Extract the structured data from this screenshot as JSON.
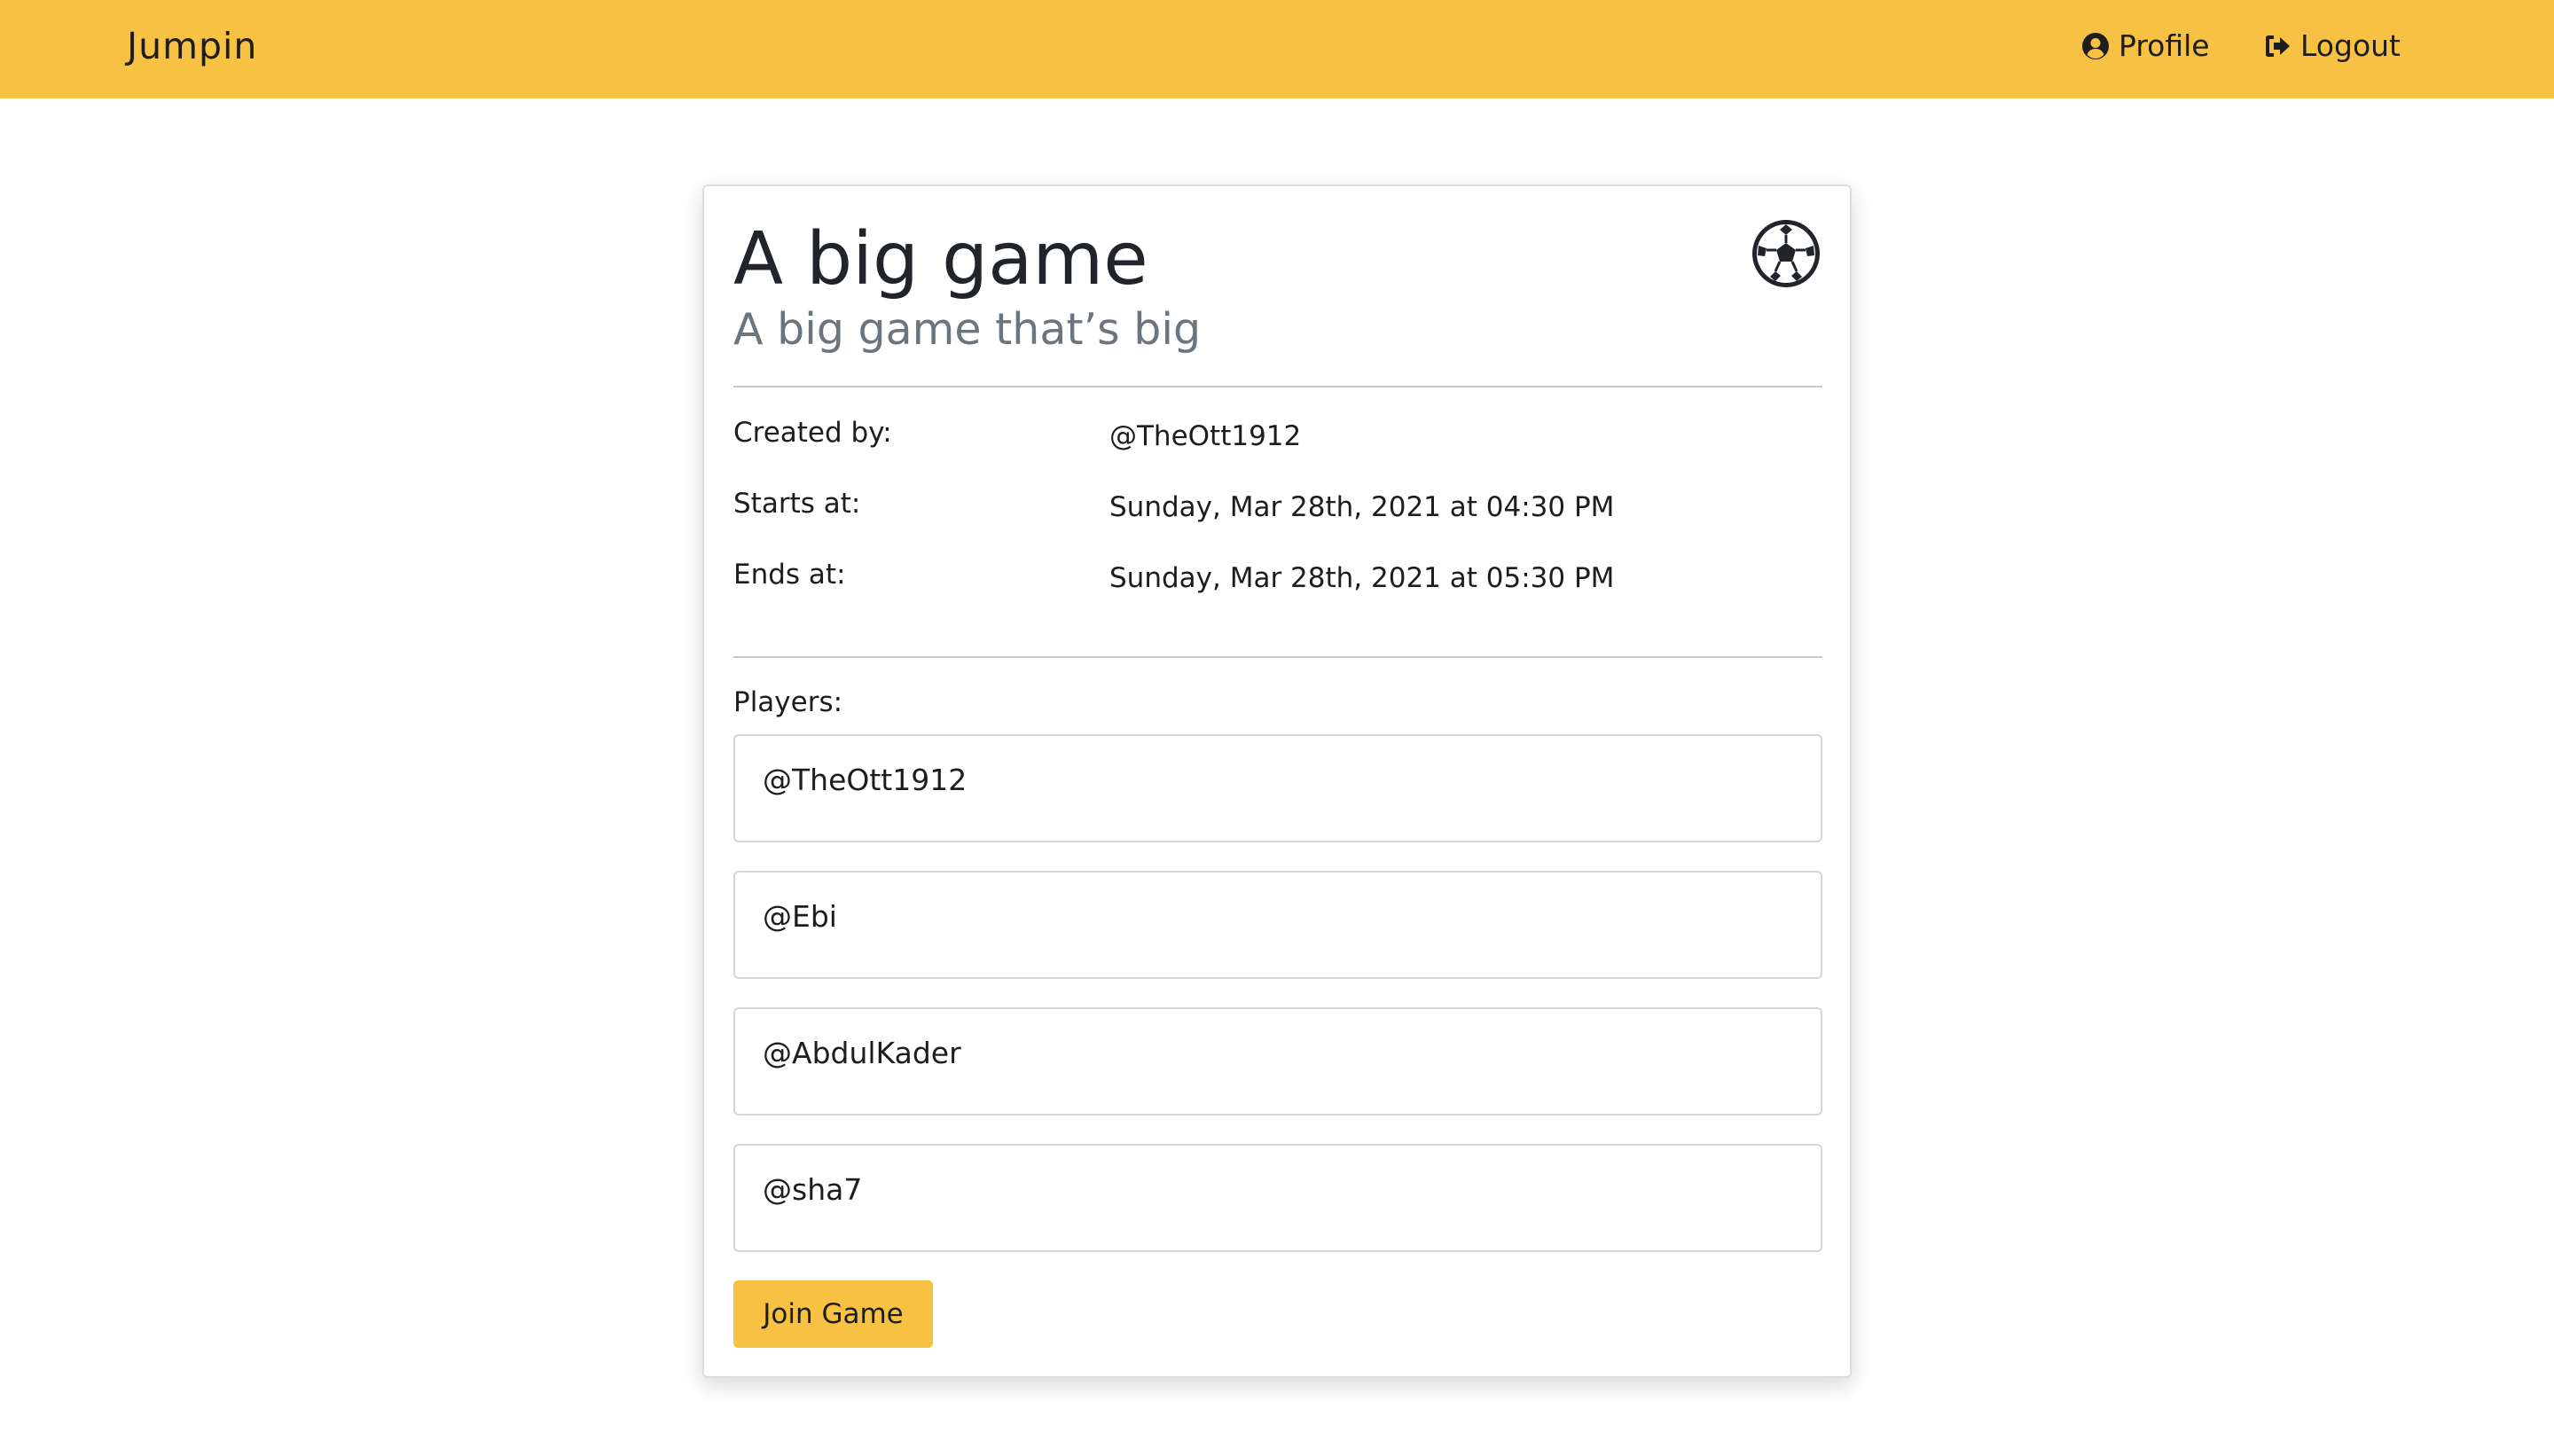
{
  "navbar": {
    "brand": "Jumpin",
    "profile_label": "Profile",
    "profile_icon": "user-circle-icon",
    "logout_label": "Logout",
    "logout_icon": "sign-out-icon",
    "background_color": "#f7c244"
  },
  "game": {
    "title": "A big game",
    "subtitle": "A big game that’s big",
    "sport_icon": "soccer-ball-icon",
    "details": {
      "created_by_label": "Created by:",
      "created_by_value": "@TheOtt1912",
      "starts_label": "Starts at:",
      "starts_value": "Sunday, Mar 28th, 2021 at 04:30 PM",
      "ends_label": "Ends at:",
      "ends_value": "Sunday, Mar 28th, 2021 at 05:30 PM"
    },
    "players_label": "Players:",
    "players": [
      "@TheOtt1912",
      "@Ebi",
      "@AbdulKader",
      "@sha7"
    ],
    "join_button_label": "Join Game"
  }
}
